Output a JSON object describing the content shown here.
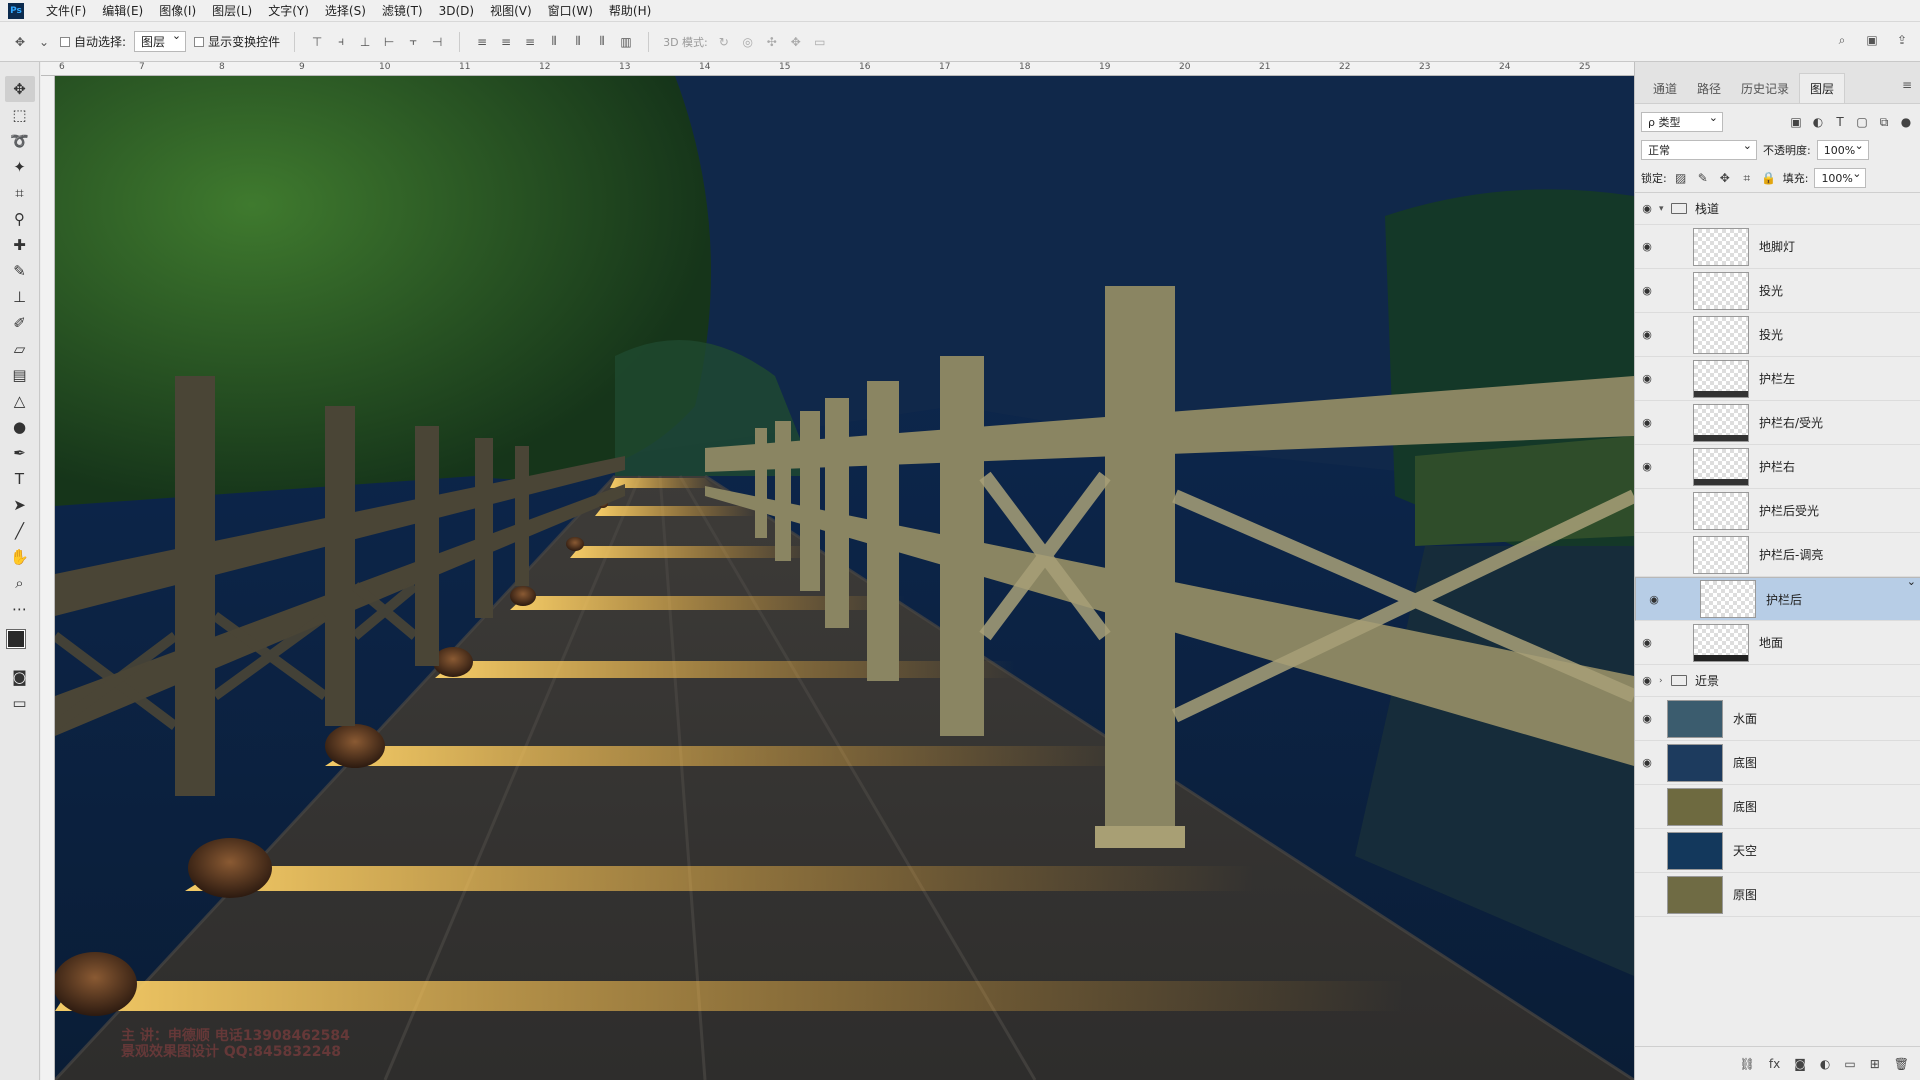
{
  "app": {
    "logo": "Ps"
  },
  "menu": [
    "文件(F)",
    "编辑(E)",
    "图像(I)",
    "图层(L)",
    "文字(Y)",
    "选择(S)",
    "滤镜(T)",
    "3D(D)",
    "视图(V)",
    "窗口(W)",
    "帮助(H)"
  ],
  "options": {
    "auto_select_label": "自动选择:",
    "auto_select_value": "图层",
    "show_transform_label": "显示变换控件",
    "mode_3d_label": "3D 模式:"
  },
  "ruler": {
    "ticks": [
      "6",
      "7",
      "8",
      "9",
      "10",
      "11",
      "12",
      "13",
      "14",
      "15",
      "16",
      "17",
      "18",
      "19",
      "20",
      "21",
      "22",
      "23",
      "24",
      "25"
    ]
  },
  "watermark": {
    "line1": "主 讲：申德顺  电话13908462584",
    "line2": "景观效果图设计 QQ:845832248"
  },
  "panel": {
    "tabs": [
      "通道",
      "路径",
      "历史记录",
      "图层"
    ],
    "active_tab": "图层",
    "filter_value": "ρ 类型",
    "blend_mode": "正常",
    "opacity_label": "不透明度:",
    "opacity_value": "100%",
    "lock_label": "锁定:",
    "fill_label": "填充:",
    "fill_value": "100%"
  },
  "colors": {
    "foreground": "#2a2a2a",
    "background": "#ecb218",
    "selection": "#b7cde6"
  }
}
